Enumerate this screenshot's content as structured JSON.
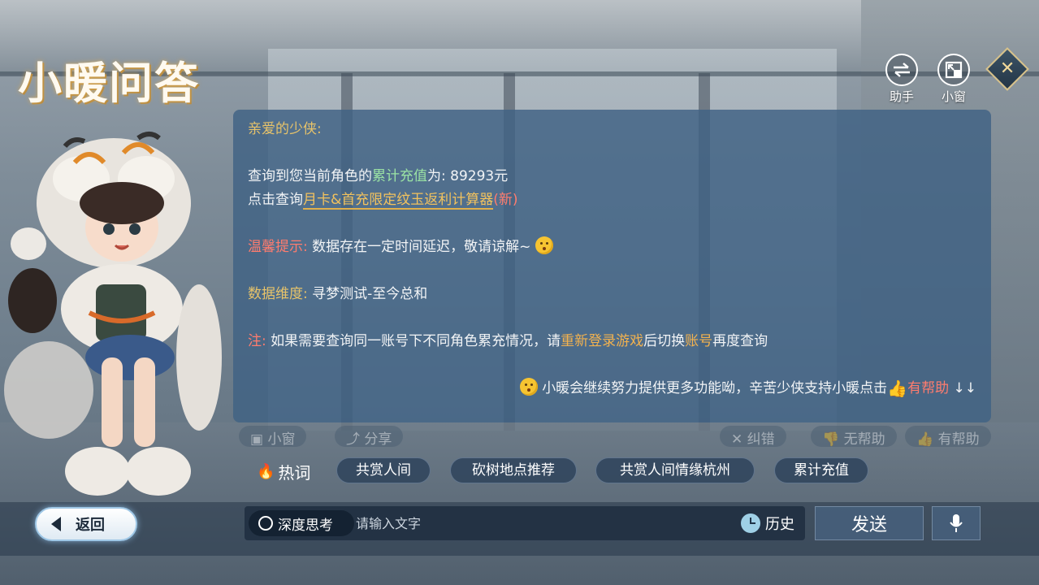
{
  "header": {
    "title": "小暖问答",
    "assistant_label": "助手",
    "mini_window_label": "小窗"
  },
  "answer": {
    "greeting": "亲爱的少侠:",
    "query_prefix": "查询到您当前角色的",
    "query_term": "累计充值",
    "query_mid": "为: ",
    "query_value": "89293元",
    "calc_prefix": "点击查询",
    "calc_link": "月卡&首充限定纹玉返利计算器",
    "calc_new": "(新)",
    "tip_label": "温馨提示:",
    "tip_text": " 数据存在一定时间延迟，敬请谅解~",
    "dimension_label": "数据维度:",
    "dimension_text": " 寻梦测试-至今总和",
    "note_label": "注:",
    "note_text_1": " 如果需要查询同一账号下不同角色累充情况，请",
    "note_highlight_1": "重新登录游戏",
    "note_text_2": "后切换",
    "note_highlight_2": "账号",
    "note_text_3": "再度查询",
    "footer_text": "小暖会继续努力提供更多功能呦，辛苦少侠支持小暖点击",
    "footer_helpful": "有帮助",
    "footer_arrows": "↓↓"
  },
  "actions": {
    "mini_window": "小窗",
    "share": "分享",
    "correct": "纠错",
    "not_helpful": "无帮助",
    "helpful": "有帮助"
  },
  "hot": {
    "label": "热词",
    "chips": [
      "共赏人间",
      "砍树地点推荐",
      "共赏人间情缘杭州",
      "累计充值"
    ]
  },
  "input": {
    "deep_think_label": "深度思考",
    "placeholder": "请输入文字",
    "history_label": "历史",
    "send_label": "发送"
  },
  "nav": {
    "back_label": "返回"
  }
}
